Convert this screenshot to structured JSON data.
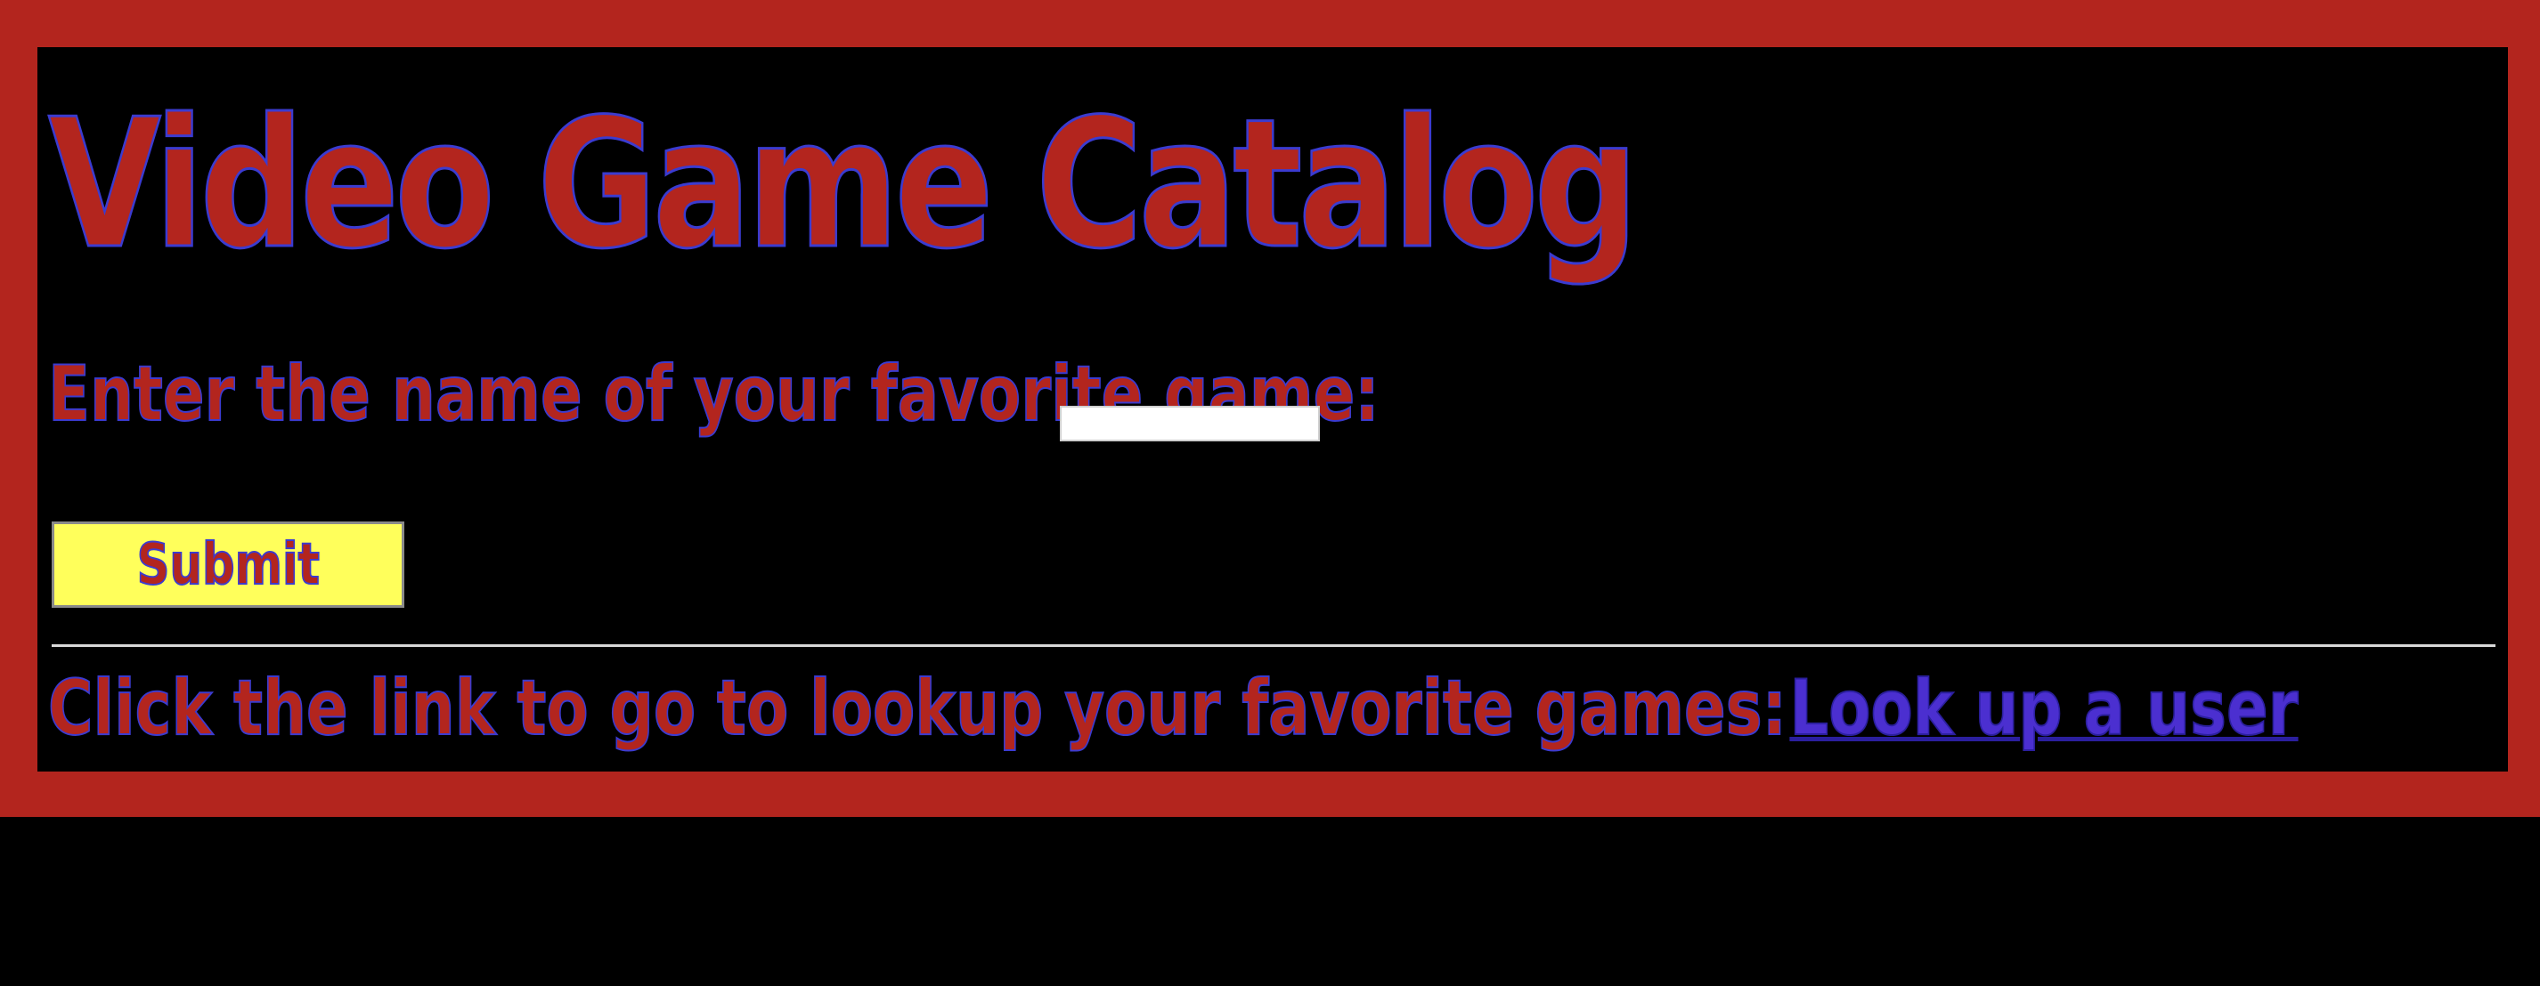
{
  "page": {
    "title": "Video Game Catalog"
  },
  "form": {
    "prompt_label": "Enter the name of your favorite game:",
    "input_value": "",
    "submit_label": "Submit"
  },
  "lookup": {
    "text": "Click the link to go to lookup your favorite games:",
    "link_label": "Look up a user"
  },
  "colors": {
    "frame": "#b3251e",
    "background": "#000000",
    "text_fill": "#b3251e",
    "text_outline": "#3b3bd0",
    "button_background": "#ffff5b",
    "link": "#4b2fd0",
    "divider": "#d8d8d8"
  }
}
